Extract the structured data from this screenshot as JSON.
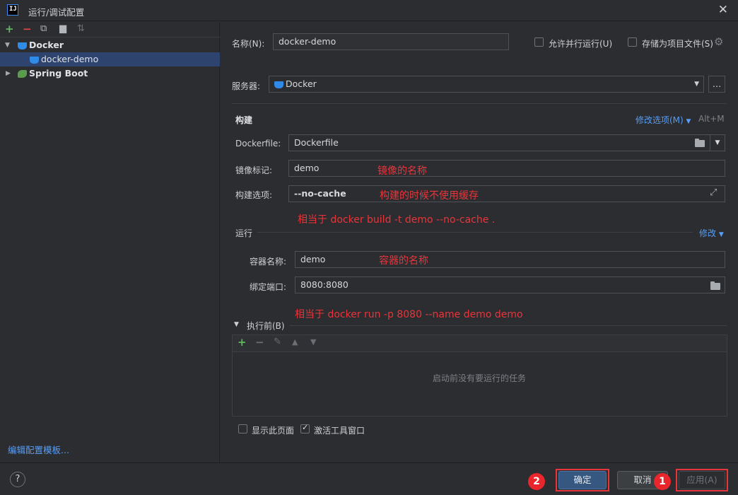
{
  "window": {
    "title": "运行/调试配置"
  },
  "tree": {
    "docker_group": "Docker",
    "docker_demo": "docker-demo",
    "spring_boot": "Spring Boot",
    "edit_templates": "编辑配置模板..."
  },
  "form": {
    "name_label": "名称(N):",
    "name_value": "docker-demo",
    "allow_parallel": "允许并行运行(U)",
    "store_as_file": "存储为项目文件(S)",
    "server_label": "服务器:",
    "server_value": "Docker",
    "build_section": "构建",
    "modify_options": "修改选项(M)",
    "modify_shortcut": "Alt+M",
    "dockerfile_label": "Dockerfile:",
    "dockerfile_value": "Dockerfile",
    "image_tag_label": "镜像标记:",
    "image_tag_value": "demo",
    "build_opts_label": "构建选项:",
    "build_opts_value": "--no-cache",
    "run_section": "运行",
    "modify_run": "修改",
    "container_name_label": "容器名称:",
    "container_name_value": "demo",
    "bind_ports_label": "绑定端口:",
    "bind_ports_value": "8080:8080",
    "before_launch": "执行前(B)",
    "no_tasks": "启动前没有要运行的任务",
    "show_page": "显示此页面",
    "activate_tool": "激活工具窗口"
  },
  "annotations": {
    "image_name": "镜像的名称",
    "no_cache": "构建的时候不使用缓存",
    "build_cmd": "相当于 docker build -t demo --no-cache .",
    "container_name": "容器的名称",
    "run_cmd": "相当于 docker run -p 8080 --name demo demo",
    "badge1": "1",
    "badge2": "2"
  },
  "buttons": {
    "help": "?",
    "ok": "确定",
    "cancel": "取消",
    "apply": "应用(A)"
  },
  "colors": {
    "accent_red": "#e8353b",
    "link_blue": "#589df6",
    "selection": "#2e436e"
  }
}
